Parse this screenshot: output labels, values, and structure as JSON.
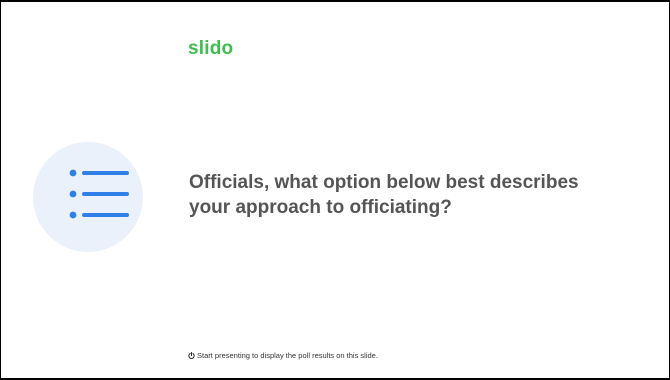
{
  "logo": {
    "text": "slido",
    "color": "#3fbd4f"
  },
  "poll_icon": {
    "name": "list-icon",
    "circle_color": "#eaf1fb",
    "accent_color": "#2f7fe8"
  },
  "question": {
    "line1": "Officials, what option below best describes",
    "line2": "your approach to officiating?"
  },
  "hint": {
    "icon": "power-icon",
    "text": "Start presenting to display the poll results on this slide."
  }
}
